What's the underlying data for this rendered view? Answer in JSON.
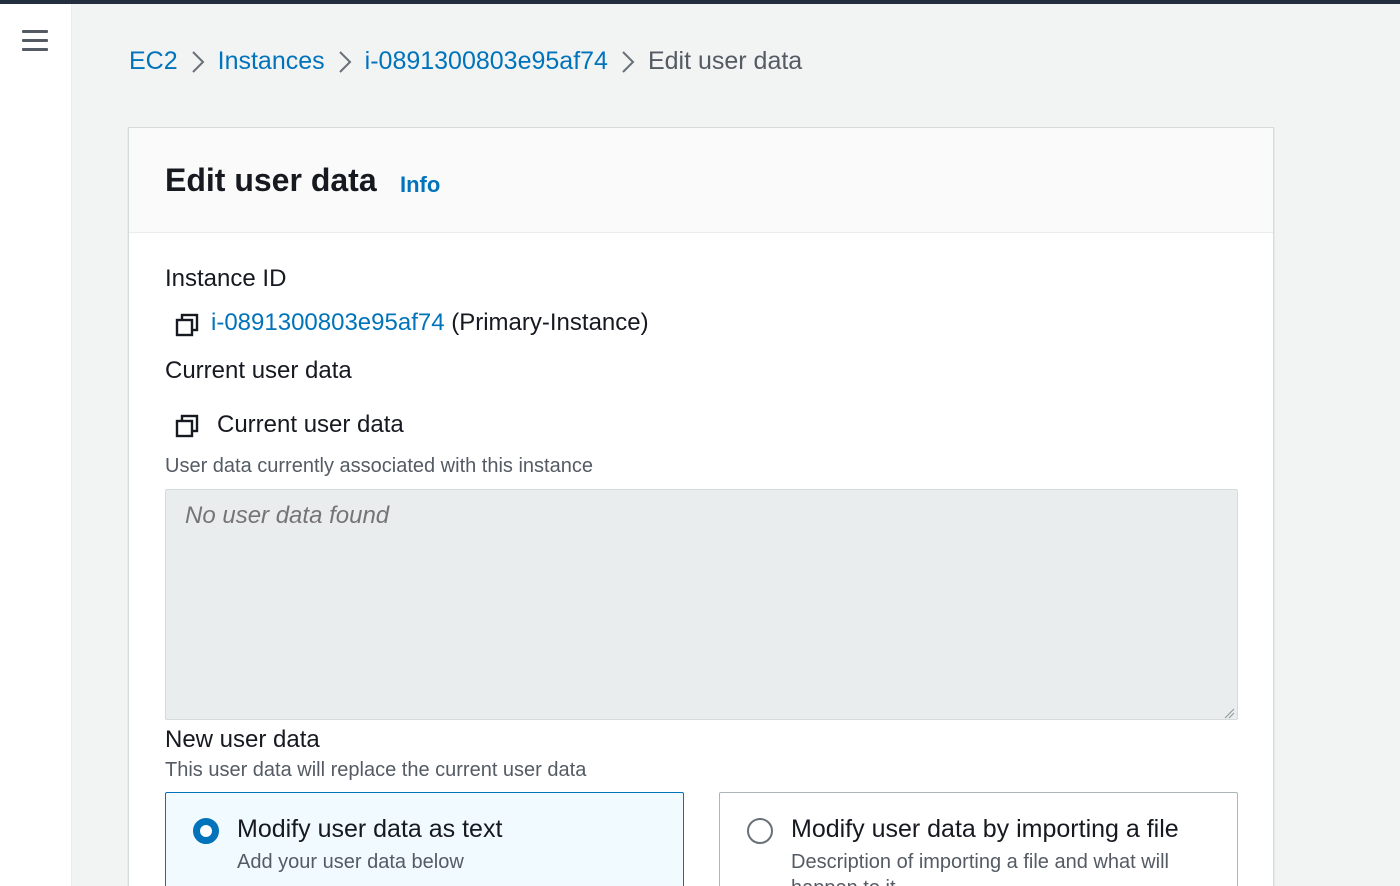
{
  "breadcrumb": {
    "items": [
      "EC2",
      "Instances",
      "i-0891300803e95af74"
    ],
    "current": "Edit user data"
  },
  "panel": {
    "title": "Edit user data",
    "info_label": "Info"
  },
  "instance": {
    "label": "Instance ID",
    "id": "i-0891300803e95af74",
    "name": "(Primary-Instance)"
  },
  "current_user_data": {
    "section_label": "Current user data",
    "copy_label": "Current user data",
    "description": "User data currently associated with this instance",
    "placeholder": "No user data found"
  },
  "new_user_data": {
    "label": "New user data",
    "description": "This user data will replace the current user data",
    "options": [
      {
        "title": "Modify user data as text",
        "description": "Add your user data below",
        "selected": true
      },
      {
        "title": "Modify user data by importing a file",
        "description": "Description of importing a file and what will happen to it",
        "selected": false
      }
    ]
  },
  "colors": {
    "link": "#0073bb",
    "text": "#16191f",
    "secondary_text": "#545b64",
    "page_background": "#f2f3f3",
    "textarea_background": "#eaeded"
  }
}
